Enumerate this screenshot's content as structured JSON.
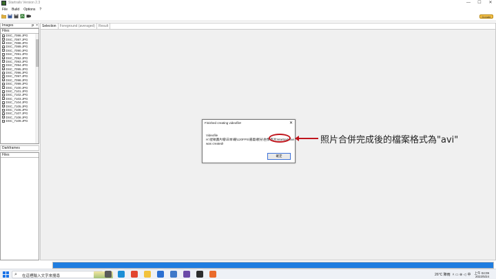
{
  "window": {
    "title": "Startrails Version 2.3",
    "controls": [
      "—",
      "☐",
      "✕"
    ]
  },
  "menu": [
    "File",
    "Build",
    "Options",
    "?"
  ],
  "toolbar": {
    "icons": [
      "open-folder-icon",
      "save-icon",
      "save-as-icon",
      "build-icon",
      "video-icon"
    ],
    "donate_label": "Donate"
  },
  "left_panel": {
    "images_title": "Images",
    "files_header": "Files",
    "files": [
      "DSC_7086.JPG",
      "DSC_7087.JPG",
      "DSC_7088.JPG",
      "DSC_7089.JPG",
      "DSC_7090.JPG",
      "DSC_7091.JPG",
      "DSC_7092.JPG",
      "DSC_7093.JPG",
      "DSC_7094.JPG",
      "DSC_7095.JPG",
      "DSC_7096.JPG",
      "DSC_7097.JPG",
      "DSC_7098.JPG",
      "DSC_7099.JPG",
      "DSC_7100.JPG",
      "DSC_7101.JPG",
      "DSC_7102.JPG",
      "DSC_7103.JPG",
      "DSC_7104.JPG",
      "DSC_7105.JPG",
      "DSC_7106.JPG",
      "DSC_7107.JPG",
      "DSC_7108.JPG",
      "DSC_7109.JPG"
    ],
    "darkframes_title": "Darkframes",
    "darkframes_header": "Files",
    "pin_symbol": "ᵽ",
    "close_symbol": "×"
  },
  "tabs": [
    "Selection",
    "Foreground (averaged)",
    "Result"
  ],
  "dialog": {
    "title": "Finished creating videofile!",
    "close_symbol": "✕",
    "line1": "Videofile",
    "line2": "H:\\星軌圖片檔\\日本\\繼\\120FPS\\嘉義\\觀光\\坐像\\影片\\startrails.avi",
    "line3": "was created!",
    "ok_label": "確定"
  },
  "annotation": {
    "text": "照片合併完成後的檔案格式為\"avi\"",
    "color": "#c0141c"
  },
  "progress": {
    "fraction": 1.0,
    "color": "#1f7de0"
  },
  "taskbar": {
    "search_placeholder": "在這裡輸入文字來搜尋",
    "search_symbol": "⌕",
    "apps": [
      {
        "name": "taskview-icon",
        "color": "#5a5a5a"
      },
      {
        "name": "edge-icon",
        "color": "#1c8fd6"
      },
      {
        "name": "chrome-icon",
        "color": "#e2452f"
      },
      {
        "name": "explorer-icon",
        "color": "#f2c23c"
      },
      {
        "name": "mail-icon",
        "color": "#2b6fd1"
      },
      {
        "name": "photos-icon",
        "color": "#3f79c9"
      },
      {
        "name": "gallery-icon",
        "color": "#6a4aa8"
      },
      {
        "name": "notepad-icon",
        "color": "#2e2e2e"
      },
      {
        "name": "firefox-icon",
        "color": "#ea6b2b"
      }
    ],
    "weather": "26°C 陣雨",
    "tray_symbols": "˄ ▭ ⊕ ◁",
    "ime": "中",
    "time": "上午 04:09",
    "date": "2022/5/24"
  }
}
